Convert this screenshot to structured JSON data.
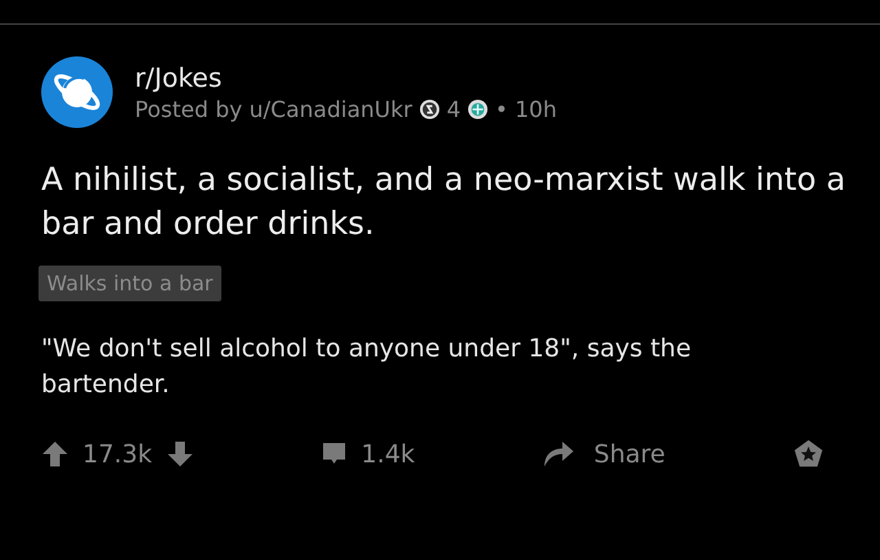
{
  "post": {
    "subreddit": "r/Jokes",
    "posted_by": "Posted by u/CanadianUkr",
    "awards": [
      {
        "kind": "silver",
        "count": "4"
      },
      {
        "kind": "helpful"
      }
    ],
    "separator": "•",
    "age": "10h",
    "title": "A nihilist, a socialist, and a neo-marxist walk into a bar and order drinks.",
    "flair": "Walks into a bar",
    "body": "\"We don't sell alcohol to anyone under 18\", says the bartender."
  },
  "actions": {
    "score": "17.3k",
    "comments": "1.4k",
    "share": "Share"
  }
}
